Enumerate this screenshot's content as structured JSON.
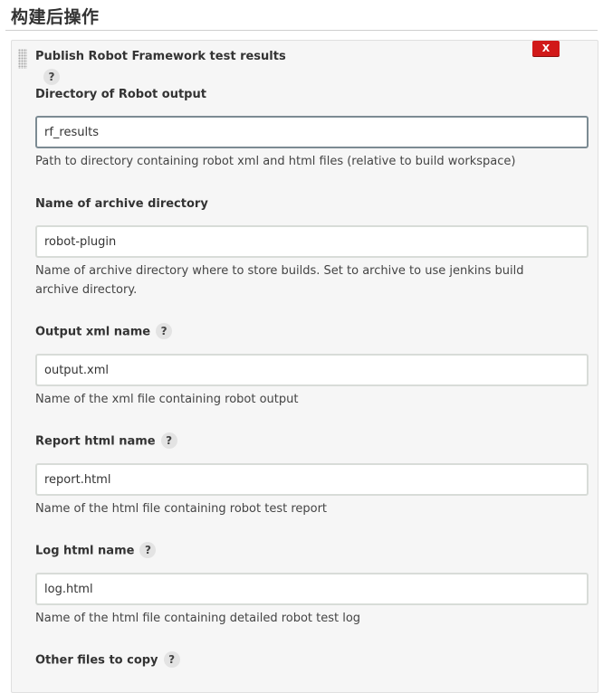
{
  "section": {
    "title": "构建后操作"
  },
  "panel": {
    "title": "Publish Robot Framework test results",
    "help_label": "?",
    "delete_label": "X"
  },
  "fields": [
    {
      "label": "Directory of Robot output",
      "value": "rf_results",
      "description": "Path to directory containing robot xml and html files (relative to build workspace)"
    },
    {
      "label": "Name of archive directory",
      "value": "robot-plugin",
      "description": "Name of archive directory where to store builds. Set to archive to use jenkins build archive directory."
    },
    {
      "label": "Output xml name",
      "help": "?",
      "value": "output.xml",
      "description": "Name of the xml file containing robot output"
    },
    {
      "label": "Report html name",
      "help": "?",
      "value": "report.html",
      "description": "Name of the html file containing robot test report"
    },
    {
      "label": "Log html name",
      "help": "?",
      "value": "log.html",
      "description": "Name of the html file containing detailed robot test log"
    },
    {
      "label": "Other files to copy",
      "help": "?"
    }
  ]
}
